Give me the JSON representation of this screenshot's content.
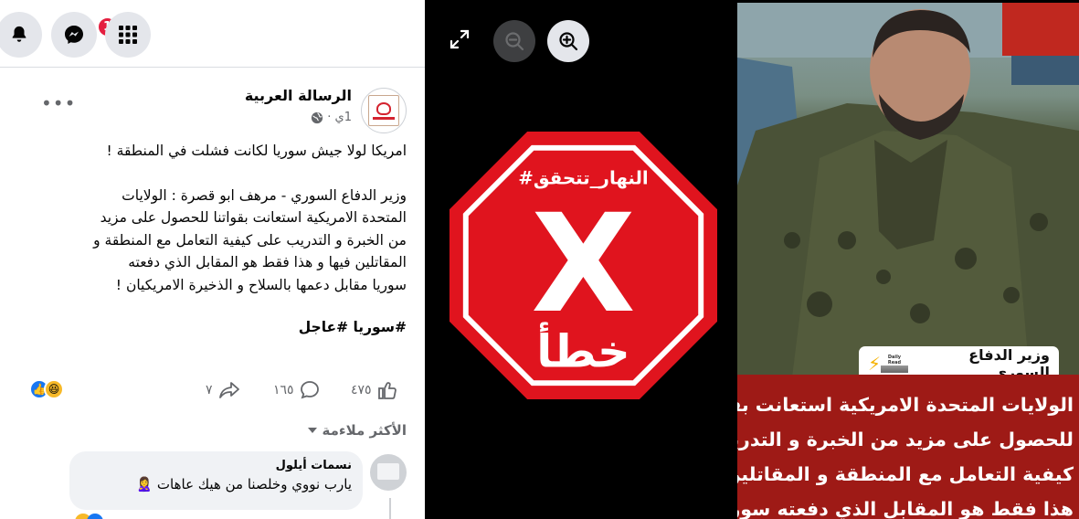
{
  "notifications": {
    "badge_count": "1"
  },
  "post": {
    "page_name": "الرسالة العربية",
    "time": "1ي ·",
    "body_lines": [
      "امريكا لولا جيش سوريا لكانت فشلت في المنطقة !",
      "",
      "وزير الدفاع السوري - مرهف ابو قصرة : الولايات",
      "المتحدة الامريكية استعانت بقواتنا للحصول على مزيد",
      "من الخبرة و التدريب على كيفية التعامل مع المنطقة و",
      "المقاتلين فيها و هذا فقط هو المقابل الذي دفعته",
      "سوريا مقابل دعمها بالسلاح و الذخيرة الامريكيان !"
    ],
    "hashtags": "#سوريا #عاجل",
    "reactions_count": "٤٧٥",
    "comments_count": "١٦٥",
    "shares_count": "٧",
    "sort_label": "الأكثر ملاءمة"
  },
  "comment": {
    "author": "نسمات أيلول",
    "text": "يارب نووي وخلصنا من هيك عاهات 🙎‍♀️"
  },
  "viewer": {
    "stop_sign_hashtag": "#النهار_تتحقق",
    "stop_sign_mark": "X",
    "stop_sign_label": "خطأ",
    "photo_tag": "وزير الدفاع السوري",
    "photo_tag_logo_text": "Daily Read",
    "banner_lines": [
      "الولايات المتحدة الامريكية استعانت بقواتنا",
      "للحصول على مزيد من الخبرة و التدريب على",
      "كيفية التعامل مع المنطقة و المقاتلين فيها و",
      "هذا فقط هو المقابل الذي دفعته سوريا"
    ]
  },
  "colors": {
    "stop_red": "#e0141e",
    "banner_red": "#9e1a16",
    "fb_blue": "#1877f2",
    "badge_red": "#e41e3f"
  },
  "icons": [
    "bell-icon",
    "messenger-icon",
    "menu-grid-icon",
    "globe-icon",
    "like-icon",
    "comment-icon",
    "share-icon",
    "expand-icon",
    "zoom-out-icon",
    "zoom-in-icon"
  ]
}
